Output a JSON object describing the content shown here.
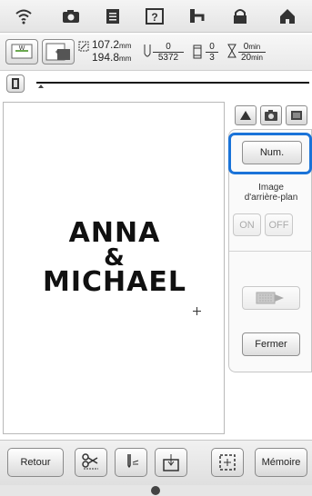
{
  "colors": {
    "highlight": "#1a73d8",
    "accent_grey": "#6e6e6e",
    "text": "#222222"
  },
  "topbar": {
    "icons": [
      "wifi-icon",
      "camera-icon",
      "document-icon",
      "help-icon",
      "threading-icon",
      "home-icon",
      "home-icon"
    ]
  },
  "info": {
    "width_value": "107.2",
    "height_value": "194.8",
    "unit": "mm",
    "stitch_num": "0",
    "stitch_den": "5372",
    "color_num": "0",
    "color_den": "3",
    "time_num": "0",
    "time_den": "20",
    "time_unit": "min"
  },
  "design": {
    "line1": "ANNA",
    "line2": "&",
    "line3": "MICHAEL"
  },
  "panel": {
    "num_label": "Num.",
    "bg_line1": "Image",
    "bg_line2": "d'arrière-plan",
    "on_label": "ON",
    "off_label": "OFF",
    "close_label": "Fermer"
  },
  "bottom": {
    "back_label": "Retour",
    "memory_label": "Mémoire"
  }
}
